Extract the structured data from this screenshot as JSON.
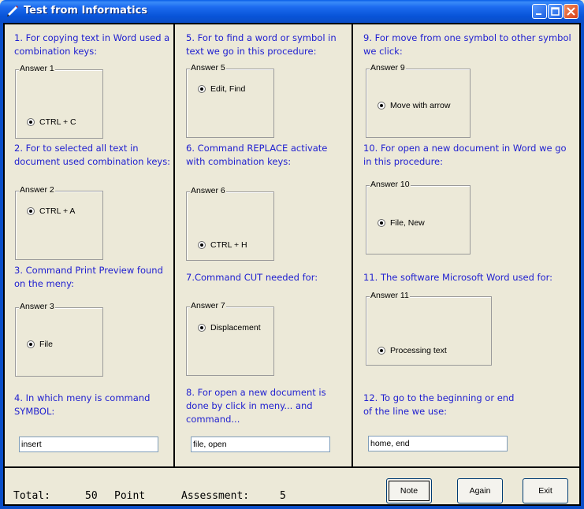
{
  "window": {
    "title": "Test from Informatics"
  },
  "columns": [
    {
      "questions": [
        {
          "text": "1. For copying text in Word used a combination keys:",
          "group": "Answer 1",
          "answer": "CTRL + C"
        },
        {
          "text": "2. For to selected all text in document used combination keys:",
          "group": "Answer 2",
          "answer": "CTRL + A"
        },
        {
          "text": "3. Command Print Preview found on the meny:",
          "group": "Answer 3",
          "answer": "File"
        },
        {
          "text": "4. In which meny is command SYMBOL:",
          "input": "insert"
        }
      ]
    },
    {
      "questions": [
        {
          "text": "5. For to find a word or symbol in text we go in this procedure:",
          "group": "Answer 5",
          "answer": "Edit, Find"
        },
        {
          "text": "6. Command REPLACE activate with combination keys:",
          "group": "Answer 6",
          "answer": "CTRL + H"
        },
        {
          "text": "7.Command CUT needed for:",
          "group": "Answer 7",
          "answer": "Displacement"
        },
        {
          "text": "8. For open a new document is done by click in meny... and command...",
          "input": "file, open"
        }
      ]
    },
    {
      "questions": [
        {
          "text": "9. For move from one symbol to other symbol we click:",
          "group": "Answer 9",
          "answer": "Move with arrow"
        },
        {
          "text": "10. For open a new document in Word we go in this procedure:",
          "group": "Answer 10",
          "answer": "File, New"
        },
        {
          "text": "11. The software Microsoft Word used for:",
          "group": "Answer 11",
          "answer": "Processing text"
        },
        {
          "text": "12. To go to the beginning or end of the line we use:",
          "input": "home, end"
        }
      ]
    }
  ],
  "footer": {
    "total_label": "Total:",
    "total_value": "50",
    "point_label": "Point",
    "assessment_label": "Assessment:",
    "assessment_value": "5",
    "buttons": {
      "note": "Note",
      "again": "Again",
      "exit": "Exit"
    }
  },
  "colors": {
    "question_text": "#2020d0",
    "titlebar": "#0a4ec8",
    "background": "#ece9d8"
  }
}
